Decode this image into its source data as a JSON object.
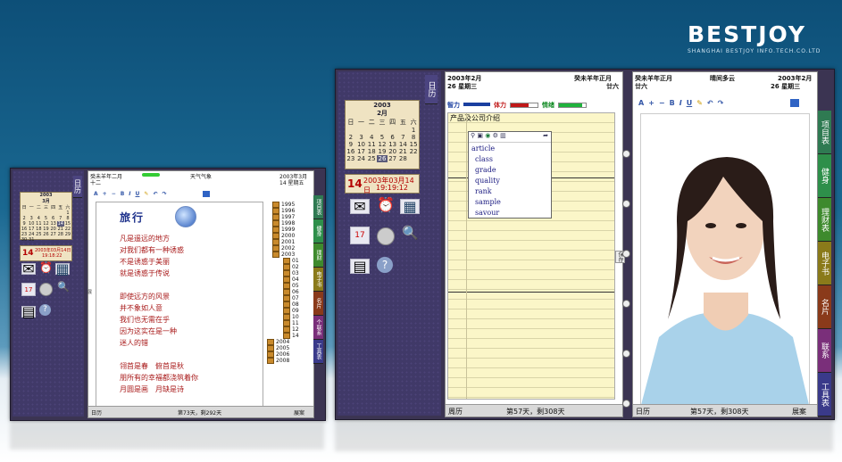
{
  "brand": {
    "name": "BESTJOY",
    "subtitle": "SHANGHAI BESTJOY INFO.TECH.CO.LTD"
  },
  "small": {
    "left_tab": "日历",
    "cal": {
      "year": "2003",
      "month": "3月",
      "weekdays": [
        "日",
        "一",
        "二",
        "三",
        "四",
        "五",
        "六"
      ],
      "days": [
        [
          "",
          "",
          "",
          "",
          "",
          "",
          "1"
        ],
        [
          "2",
          "3",
          "4",
          "5",
          "6",
          "7",
          "8"
        ],
        [
          "9",
          "10",
          "11",
          "12",
          "13",
          "14",
          "15"
        ],
        [
          "16",
          "17",
          "18",
          "19",
          "20",
          "21",
          "22"
        ],
        [
          "23",
          "24",
          "25",
          "26",
          "27",
          "28",
          "29"
        ],
        [
          "30",
          "31",
          "",
          "",
          "",
          "",
          ""
        ]
      ],
      "selected": "14"
    },
    "datebox": {
      "day": "14",
      "date": "2003年03月14日",
      "time": "19:18:22"
    },
    "header": {
      "lunar": "癸未羊年二月",
      "lunar2": "十二",
      "weather": "天气气象",
      "date": "2003年3月",
      "weekday": "14  星期五"
    },
    "toolbar": [
      "A",
      "+",
      "−",
      "B",
      "I",
      "U"
    ],
    "poem_title": "旅行",
    "poem": [
      "凡是遥远的地方",
      "对我们都有一种诱惑",
      "不是诱惑于美丽",
      "就是诱惑于传说",
      "",
      "即使远方的风景",
      "并不象如人意",
      "我们也无需在乎",
      "因为这实在是一种",
      "迷人的错",
      "",
      "翎首是春　俯首是秋",
      "朋所有的幸福都浇筑着你",
      "月圆是画　月缺是诗"
    ],
    "years": [
      "1995",
      "1996",
      "1997",
      "1998",
      "1999",
      "2000",
      "2001",
      "2002",
      "2003"
    ],
    "months": [
      "01",
      "02",
      "03",
      "04",
      "05",
      "06",
      "07",
      "08",
      "09",
      "10",
      "11",
      "12",
      "14"
    ],
    "years2": [
      "2004",
      "2005",
      "2006",
      "2008"
    ],
    "right_tabs": [
      "项目表",
      "健身",
      "理财",
      "电子书",
      "名片",
      "个联系",
      "工具表"
    ],
    "footer": {
      "left": "日历",
      "mid": "第73天，剩292天",
      "right": "展案"
    }
  },
  "large": {
    "left_tab": "日历",
    "cal": {
      "year": "2003",
      "month": "2月",
      "weekdays": [
        "日",
        "一",
        "二",
        "三",
        "四",
        "五",
        "六"
      ],
      "days": [
        [
          "",
          "",
          "",
          "",
          "",
          "",
          "1"
        ],
        [
          "2",
          "3",
          "4",
          "5",
          "6",
          "7",
          "8"
        ],
        [
          "9",
          "10",
          "11",
          "12",
          "13",
          "14",
          "15"
        ],
        [
          "16",
          "17",
          "18",
          "19",
          "20",
          "21",
          "22"
        ],
        [
          "23",
          "24",
          "25",
          "26",
          "27",
          "28",
          ""
        ]
      ],
      "selected": "26"
    },
    "datebox": {
      "day": "14",
      "date": "2003年03月14日",
      "time": "19:19:12"
    },
    "header_left": {
      "date": "2003年2月",
      "day": "26  星期三",
      "lunar": "癸未羊年正月",
      "lunar2": "廿六"
    },
    "header_right": {
      "lunar": "癸未羊年正月",
      "weather": "晴间多云",
      "date": "2003年2月",
      "lunar2": "廿六",
      "weekday": "26  星期三"
    },
    "bio": {
      "a": "智力",
      "b": "体力",
      "c": "情绪"
    },
    "note_title": "产品及公司介绍",
    "popup": [
      "article",
      "class",
      "grade",
      "quality",
      "rank",
      "sample",
      "savour"
    ],
    "right_tabs": [
      "项目表",
      "健身",
      "理财表",
      "电子书",
      "名片",
      "联系",
      "工具表"
    ],
    "side_tab": "保存",
    "footer_left": {
      "left": "周历",
      "mid": "第57天，剩308天"
    },
    "footer_right": {
      "left": "日历",
      "mid": "第57天，剩308天",
      "right": "展案"
    }
  },
  "colors": {
    "accent": "#3b3452",
    "calendar_bg": "#efe3c2",
    "note_bg": "#fbf6c8",
    "date_red": "#b30000"
  }
}
